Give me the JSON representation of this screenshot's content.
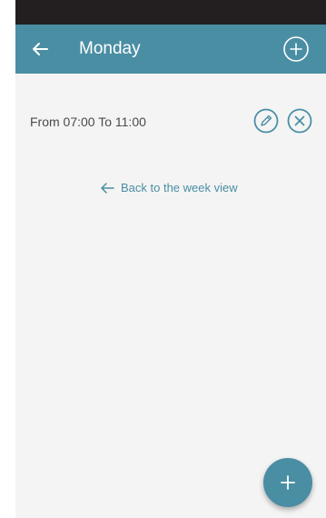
{
  "header": {
    "title": "Monday",
    "back_icon": "arrow-left-icon",
    "add_icon": "plus-circle-icon"
  },
  "slots": [
    {
      "label": "From 07:00 To 11:00",
      "edit_icon": "pencil-circle-icon",
      "delete_icon": "close-circle-icon"
    }
  ],
  "back_link": {
    "label": "Back to the week view",
    "icon": "arrow-left-icon"
  },
  "fab": {
    "icon": "plus-icon"
  },
  "colors": {
    "accent": "#4a8ea4",
    "status_bar": "#231f20",
    "background": "#f4f4f4",
    "text": "#4a4a4a"
  }
}
